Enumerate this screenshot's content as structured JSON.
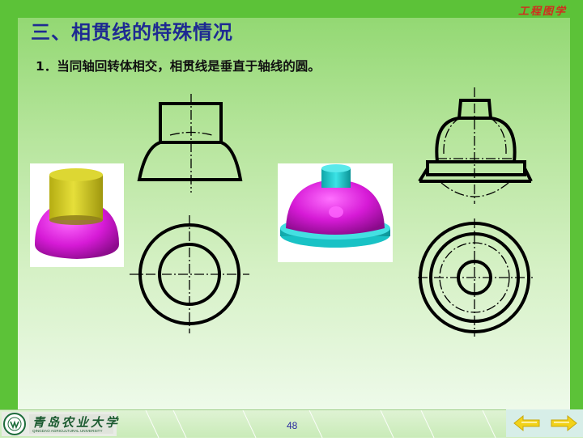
{
  "header": {
    "brand": "工程图学",
    "title": "三、相贯线的特殊情况"
  },
  "content": {
    "point_1": "1．当同轴回转体相交，相贯线是垂直于轴线的圆。"
  },
  "footer": {
    "logo_text": "青岛农业大学",
    "logo_subtext": "QINGDAO AGRICULTURAL UNIVERSITY",
    "page_number": "48"
  },
  "colors": {
    "title": "#1e2a92",
    "brand": "#d22c1e",
    "magenta": "#d61ad6",
    "olive": "#c9c31a",
    "cyan": "#1fcfd2",
    "nav_arrow": "#f2d21a"
  },
  "icons": {
    "prev": "left-arrow-icon",
    "next": "right-arrow-icon"
  }
}
